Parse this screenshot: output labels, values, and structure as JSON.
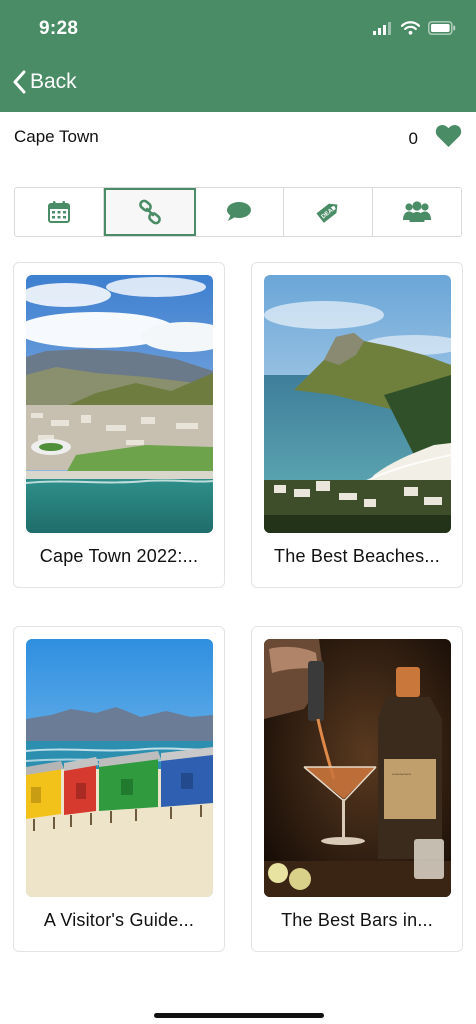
{
  "status_bar": {
    "time": "9:28"
  },
  "nav": {
    "back_label": "Back"
  },
  "city": {
    "name": "Cape Town",
    "favorites_count": "0"
  },
  "tabs": [
    {
      "icon": "calendar-icon",
      "active": false
    },
    {
      "icon": "link-icon",
      "active": true
    },
    {
      "icon": "chat-bubble-icon",
      "active": false
    },
    {
      "icon": "deal-tag-icon",
      "active": false
    },
    {
      "icon": "group-icon",
      "active": false
    }
  ],
  "cards": [
    {
      "title": "Cape Town 2022:..."
    },
    {
      "title": "The Best Beaches..."
    },
    {
      "title": "A Visitor's Guide..."
    },
    {
      "title": "The Best Bars in..."
    }
  ],
  "colors": {
    "brand": "#4a8c66",
    "tab_icon": "#4a8c66"
  }
}
